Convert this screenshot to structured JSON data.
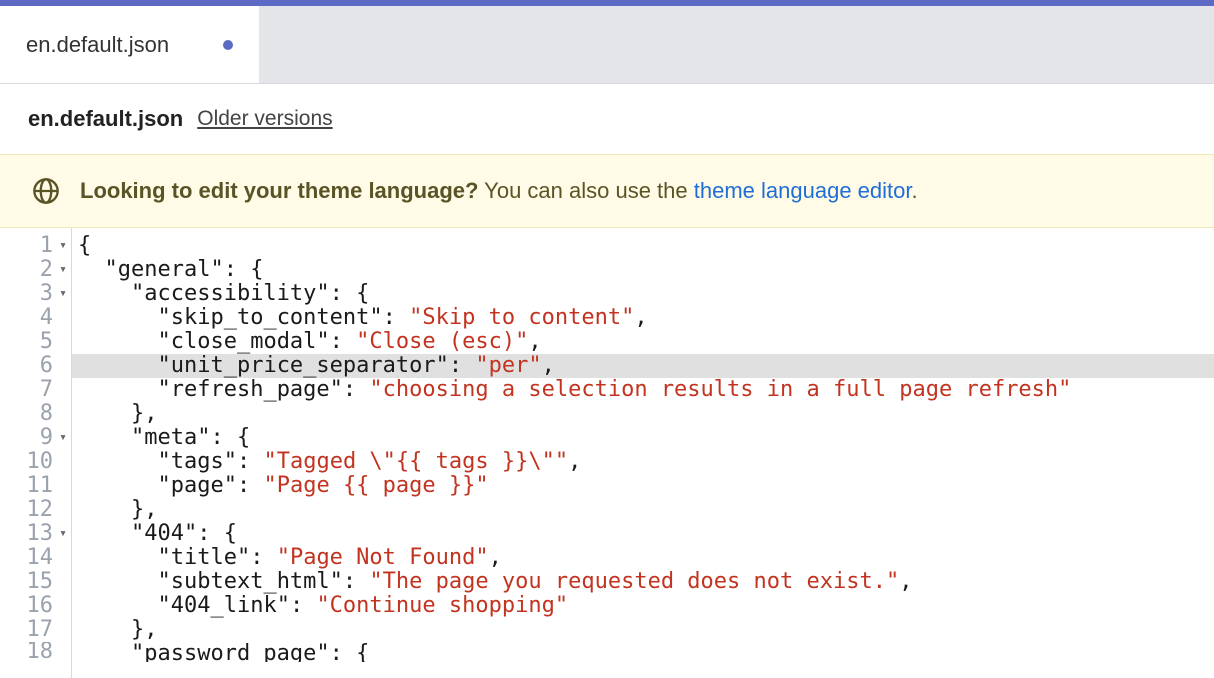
{
  "tab": {
    "label": "en.default.json",
    "dirty": true
  },
  "header": {
    "filename": "en.default.json",
    "older_label": "Older versions"
  },
  "banner": {
    "strong": "Looking to edit your theme language?",
    "rest": " You can also use the ",
    "link": "theme language editor",
    "period": "."
  },
  "gutter": [
    {
      "n": "1",
      "fold": true
    },
    {
      "n": "2",
      "fold": true
    },
    {
      "n": "3",
      "fold": true
    },
    {
      "n": "4",
      "fold": false
    },
    {
      "n": "5",
      "fold": false
    },
    {
      "n": "6",
      "fold": false
    },
    {
      "n": "7",
      "fold": false
    },
    {
      "n": "8",
      "fold": false
    },
    {
      "n": "9",
      "fold": true
    },
    {
      "n": "10",
      "fold": false
    },
    {
      "n": "11",
      "fold": false
    },
    {
      "n": "12",
      "fold": false
    },
    {
      "n": "13",
      "fold": true
    },
    {
      "n": "14",
      "fold": false
    },
    {
      "n": "15",
      "fold": false
    },
    {
      "n": "16",
      "fold": false
    },
    {
      "n": "17",
      "fold": false
    },
    {
      "n": "18",
      "fold": false
    }
  ],
  "code": {
    "l1": "{",
    "l2_key": "\"general\"",
    "l2_rest": ": {",
    "l3_key": "\"accessibility\"",
    "l3_rest": ": {",
    "l4_key": "\"skip_to_content\"",
    "l4_val": "\"Skip to content\"",
    "l5_key": "\"close_modal\"",
    "l5_val": "\"Close (esc)\"",
    "l6_key": "\"unit_price_separator\"",
    "l6_val": "\"per\"",
    "l7_key": "\"refresh_page\"",
    "l7_val": "\"choosing a selection results in a full page refresh\"",
    "l8": "},",
    "l9_key": "\"meta\"",
    "l9_rest": ": {",
    "l10_key": "\"tags\"",
    "l10_val": "\"Tagged \\\"{{ tags }}\\\"\"",
    "l11_key": "\"page\"",
    "l11_val": "\"Page {{ page }}\"",
    "l12": "},",
    "l13_key": "\"404\"",
    "l13_rest": ": {",
    "l14_key": "\"title\"",
    "l14_val": "\"Page Not Found\"",
    "l15_key": "\"subtext_html\"",
    "l15_val": "\"The page you requested does not exist.\"",
    "l16_key": "\"404_link\"",
    "l16_val": "\"Continue shopping\"",
    "l17": "},",
    "l18_key": "\"password_page\"",
    "l18_rest": ": {"
  }
}
